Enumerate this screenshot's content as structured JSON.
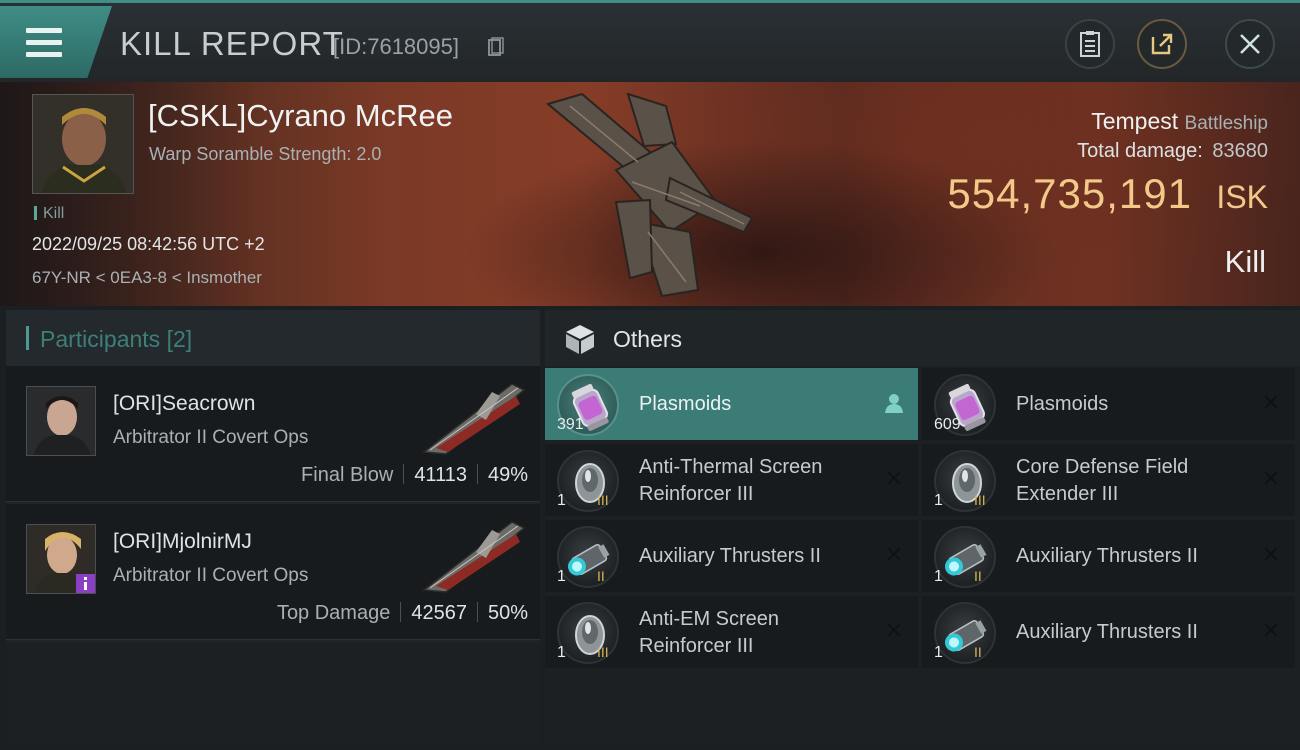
{
  "header": {
    "title": "KILL REPORT",
    "report_id": "[ID:7618095]",
    "icons": {
      "menu": "hamburger-icon",
      "copy": "copy-icon",
      "clipboard": "clipboard-icon",
      "share": "share-icon",
      "close": "close-icon"
    }
  },
  "victim": {
    "name": "[CSKL]Cyrano McRee",
    "subtitle": "Warp Soramble Strength: 2.0",
    "tag": "Kill",
    "time": "2022/09/25 08:42:56 UTC +2",
    "location": "67Y-NR < 0EA3-8 < Insmother",
    "ship_name": "Tempest",
    "ship_class": "Battleship",
    "total_damage_label": "Total damage:",
    "total_damage": "83680",
    "isk_value": "554,735,191",
    "isk_unit": "ISK",
    "result": "Kill"
  },
  "participants": {
    "title": "Participants",
    "count": "[2]",
    "rows": [
      {
        "name": "[ORI]Seacrown",
        "ship": "Arbitrator II Covert Ops",
        "label": "Final Blow",
        "damage": "41113",
        "percent": "49%"
      },
      {
        "name": "[ORI]MjolnirMJ",
        "ship": "Arbitrator II Covert Ops",
        "label": "Top Damage",
        "damage": "42567",
        "percent": "50%"
      }
    ]
  },
  "others": {
    "title": "Others",
    "items": [
      {
        "name_l1": "Plasmoids",
        "name_l2": "",
        "qty": "391",
        "meta": "",
        "icon": "plasmoid-icon",
        "selected": true
      },
      {
        "name_l1": "Plasmoids",
        "name_l2": "",
        "qty": "609",
        "meta": "",
        "icon": "plasmoid-icon",
        "selected": false
      },
      {
        "name_l1": "Anti-Thermal Screen",
        "name_l2": "Reinforcer III",
        "qty": "1",
        "meta": "III",
        "icon": "shield-module-icon",
        "selected": false
      },
      {
        "name_l1": "Core Defense Field",
        "name_l2": "Extender III",
        "qty": "1",
        "meta": "III",
        "icon": "shield-module-icon",
        "selected": false
      },
      {
        "name_l1": "Auxiliary Thrusters II",
        "name_l2": "",
        "qty": "1",
        "meta": "II",
        "icon": "thruster-icon",
        "selected": false
      },
      {
        "name_l1": "Auxiliary Thrusters II",
        "name_l2": "",
        "qty": "1",
        "meta": "II",
        "icon": "thruster-icon",
        "selected": false
      },
      {
        "name_l1": "Anti-EM Screen",
        "name_l2": "Reinforcer III",
        "qty": "1",
        "meta": "III",
        "icon": "shield-module-icon",
        "selected": false
      },
      {
        "name_l1": "Auxiliary Thrusters II",
        "name_l2": "",
        "qty": "1",
        "meta": "II",
        "icon": "thruster-icon",
        "selected": false
      }
    ],
    "close_glyph": "✕"
  },
  "colors": {
    "accent": "#3b7c76",
    "isk": "#f3c98a",
    "banner": "#7a3a26"
  }
}
